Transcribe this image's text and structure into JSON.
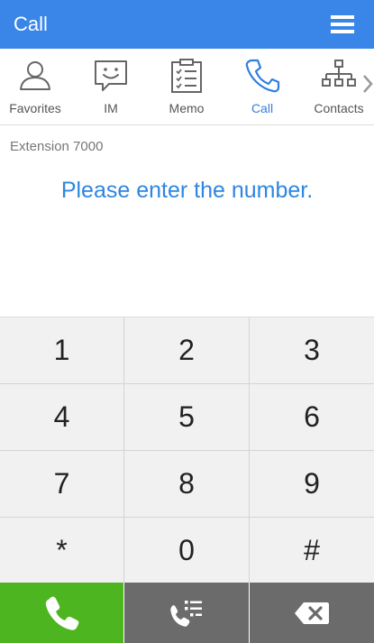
{
  "header": {
    "title": "Call"
  },
  "tabs": [
    {
      "label": "Favorites",
      "icon": "person-icon"
    },
    {
      "label": "IM",
      "icon": "chat-smile-icon"
    },
    {
      "label": "Memo",
      "icon": "clipboard-checklist-icon"
    },
    {
      "label": "Call",
      "icon": "phone-icon",
      "active": true
    },
    {
      "label": "Contacts",
      "icon": "org-chart-icon"
    }
  ],
  "status": {
    "extension": "Extension 7000",
    "prompt": "Please enter the number."
  },
  "keypad": {
    "keys": [
      "1",
      "2",
      "3",
      "4",
      "5",
      "6",
      "7",
      "8",
      "9",
      "*",
      "0",
      "#"
    ]
  },
  "actions": {
    "call": {
      "icon": "phone-icon",
      "color": "#4db51f"
    },
    "call_log": {
      "icon": "call-log-icon",
      "color": "#6b6b6b"
    },
    "backspace": {
      "icon": "backspace-icon",
      "color": "#6b6b6b"
    }
  },
  "colors": {
    "accent": "#3a86e8",
    "active_tab": "#2f7fe0",
    "prompt_text": "#2f86e0",
    "key_bg": "#f1f1f1"
  }
}
